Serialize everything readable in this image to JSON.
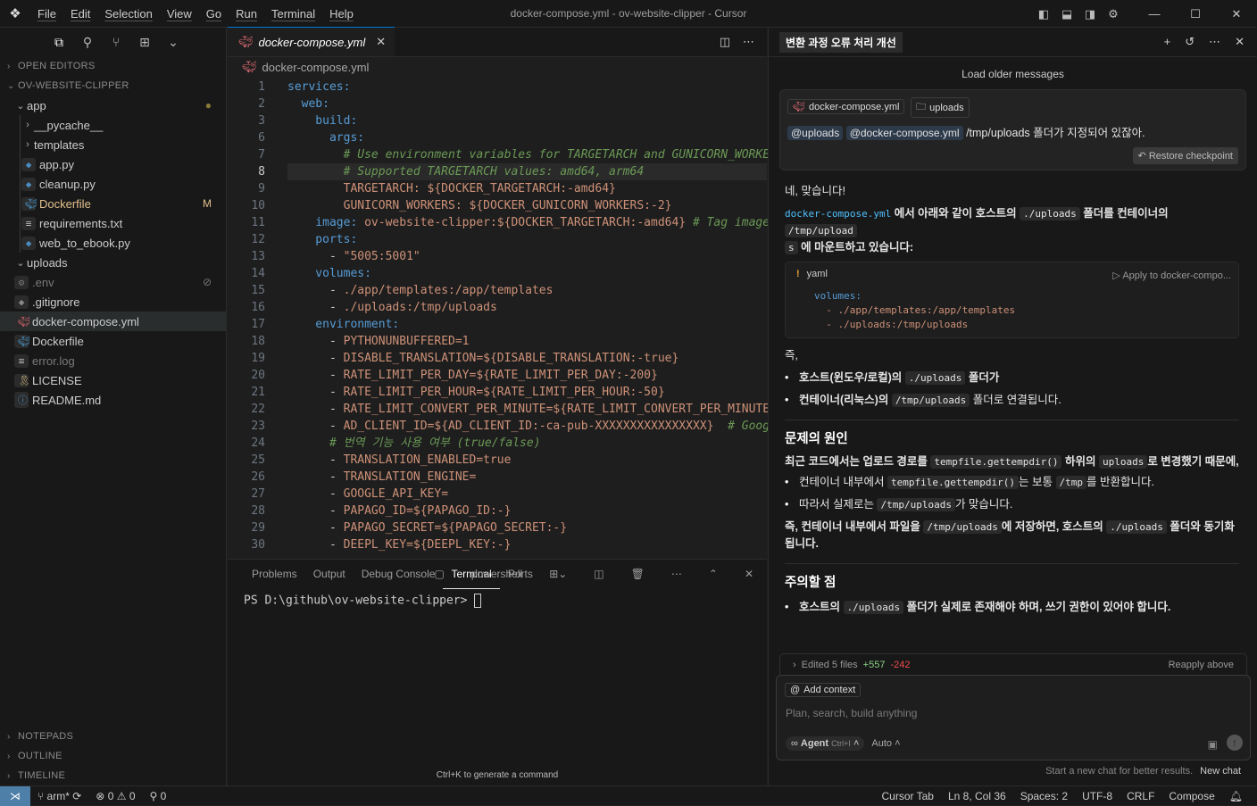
{
  "titlebar": {
    "menus": [
      "File",
      "Edit",
      "Selection",
      "View",
      "Go",
      "Run",
      "Terminal",
      "Help"
    ],
    "window_title": "docker-compose.yml - ov-website-clipper - Cursor"
  },
  "sidebar": {
    "open_editors": "OPEN EDITORS",
    "project": "OV-WEBSITE-CLIPPER",
    "tree": [
      {
        "label": "app",
        "type": "folder-open",
        "depth": 0,
        "badge": "●",
        "badge_color": "#8a7a3a",
        "color": "#cccccc"
      },
      {
        "label": "__pycache__",
        "type": "folder",
        "depth": 1
      },
      {
        "label": "templates",
        "type": "folder",
        "depth": 1
      },
      {
        "label": "app.py",
        "type": "file-py",
        "depth": 1
      },
      {
        "label": "cleanup.py",
        "type": "file-py",
        "depth": 1
      },
      {
        "label": "Dockerfile",
        "type": "file-docker",
        "depth": 1,
        "badge": "M",
        "badge_color": "#e2c08d",
        "color": "#e2c08d"
      },
      {
        "label": "requirements.txt",
        "type": "file-txt",
        "depth": 1
      },
      {
        "label": "web_to_ebook.py",
        "type": "file-py",
        "depth": 1
      },
      {
        "label": "uploads",
        "type": "folder-open",
        "depth": 0
      },
      {
        "label": ".env",
        "type": "file-gear",
        "depth": 0,
        "dim": true,
        "badge": "⊘"
      },
      {
        "label": ".gitignore",
        "type": "file-git",
        "depth": 0
      },
      {
        "label": "docker-compose.yml",
        "type": "file-compose",
        "depth": 0,
        "selected": true
      },
      {
        "label": "Dockerfile",
        "type": "file-docker",
        "depth": 0
      },
      {
        "label": "error.log",
        "type": "file-txt",
        "depth": 0,
        "dim": true
      },
      {
        "label": "LICENSE",
        "type": "file-license",
        "depth": 0
      },
      {
        "label": "README.md",
        "type": "file-info",
        "depth": 0
      }
    ],
    "bottom_sections": [
      "NOTEPADS",
      "OUTLINE",
      "TIMELINE"
    ]
  },
  "editor": {
    "tab_label": "docker-compose.yml",
    "breadcrumb": "docker-compose.yml",
    "current_line": 8,
    "lines": [
      {
        "n": "1",
        "segs": [
          {
            "t": "services:",
            "c": "k"
          }
        ]
      },
      {
        "n": "2",
        "segs": [
          {
            "t": "  web:",
            "c": "k"
          }
        ]
      },
      {
        "n": "3",
        "segs": [
          {
            "t": "    build:",
            "c": "k"
          }
        ]
      },
      {
        "n": "6",
        "segs": [
          {
            "t": "      args:",
            "c": "k"
          }
        ]
      },
      {
        "n": "7",
        "segs": [
          {
            "t": "        # Use environment variables for TARGETARCH and GUNICORN_WORKERS",
            "c": "c"
          }
        ]
      },
      {
        "n": "8",
        "segs": [
          {
            "t": "        # Supported TARGETARCH values: amd64, arm64",
            "c": "c"
          }
        ]
      },
      {
        "n": "9",
        "segs": [
          {
            "t": "        TARGETARCH: ${DOCKER_TARGETARCH:-amd64}",
            "c": "s"
          }
        ]
      },
      {
        "n": "10",
        "segs": [
          {
            "t": "        GUNICORN_WORKERS: ${DOCKER_GUNICORN_WORKERS:-2}",
            "c": "s"
          }
        ]
      },
      {
        "n": "11",
        "segs": [
          {
            "t": "    image: ",
            "c": "k"
          },
          {
            "t": "ov-website-clipper:${DOCKER_TARGETARCH:-amd64}",
            "c": "s"
          },
          {
            "t": " # Tag image",
            "c": "c"
          }
        ]
      },
      {
        "n": "12",
        "segs": [
          {
            "t": "    ports:",
            "c": "k"
          }
        ]
      },
      {
        "n": "13",
        "segs": [
          {
            "t": "      - ",
            "c": "p"
          },
          {
            "t": "\"5005:5001\"",
            "c": "s"
          }
        ]
      },
      {
        "n": "14",
        "segs": [
          {
            "t": "    volumes:",
            "c": "k"
          }
        ]
      },
      {
        "n": "15",
        "segs": [
          {
            "t": "      - ",
            "c": "p"
          },
          {
            "t": "./app/templates:/app/templates",
            "c": "s"
          }
        ]
      },
      {
        "n": "16",
        "segs": [
          {
            "t": "      - ",
            "c": "p"
          },
          {
            "t": "./uploads:/tmp/uploads",
            "c": "s"
          }
        ]
      },
      {
        "n": "17",
        "segs": [
          {
            "t": "    environment:",
            "c": "k"
          }
        ]
      },
      {
        "n": "18",
        "segs": [
          {
            "t": "      - ",
            "c": "p"
          },
          {
            "t": "PYTHONUNBUFFERED=1",
            "c": "s"
          }
        ]
      },
      {
        "n": "19",
        "segs": [
          {
            "t": "      - ",
            "c": "p"
          },
          {
            "t": "DISABLE_TRANSLATION=${DISABLE_TRANSLATION:-true}",
            "c": "s"
          }
        ]
      },
      {
        "n": "20",
        "segs": [
          {
            "t": "      - ",
            "c": "p"
          },
          {
            "t": "RATE_LIMIT_PER_DAY=${RATE_LIMIT_PER_DAY:-200}",
            "c": "s"
          }
        ]
      },
      {
        "n": "21",
        "segs": [
          {
            "t": "      - ",
            "c": "p"
          },
          {
            "t": "RATE_LIMIT_PER_HOUR=${RATE_LIMIT_PER_HOUR:-50}",
            "c": "s"
          }
        ]
      },
      {
        "n": "22",
        "segs": [
          {
            "t": "      - ",
            "c": "p"
          },
          {
            "t": "RATE_LIMIT_CONVERT_PER_MINUTE=${RATE_LIMIT_CONVERT_PER_MINUTE:",
            "c": "s"
          }
        ]
      },
      {
        "n": "23",
        "segs": [
          {
            "t": "      - ",
            "c": "p"
          },
          {
            "t": "AD_CLIENT_ID=${AD_CLIENT_ID:-ca-pub-XXXXXXXXXXXXXXXX}",
            "c": "s"
          },
          {
            "t": "  # Googl",
            "c": "c"
          }
        ]
      },
      {
        "n": "24",
        "segs": [
          {
            "t": "      # 번역 기능 사용 여부 (true/false)",
            "c": "c"
          }
        ]
      },
      {
        "n": "25",
        "segs": [
          {
            "t": "      - ",
            "c": "p"
          },
          {
            "t": "TRANSLATION_ENABLED=true",
            "c": "s"
          }
        ]
      },
      {
        "n": "26",
        "segs": [
          {
            "t": "      - ",
            "c": "p"
          },
          {
            "t": "TRANSLATION_ENGINE=",
            "c": "s"
          }
        ]
      },
      {
        "n": "27",
        "segs": [
          {
            "t": "      - ",
            "c": "p"
          },
          {
            "t": "GOOGLE_API_KEY=",
            "c": "s"
          }
        ]
      },
      {
        "n": "28",
        "segs": [
          {
            "t": "      - ",
            "c": "p"
          },
          {
            "t": "PAPAGO_ID=${PAPAGO_ID:-}",
            "c": "s"
          }
        ]
      },
      {
        "n": "29",
        "segs": [
          {
            "t": "      - ",
            "c": "p"
          },
          {
            "t": "PAPAGO_SECRET=${PAPAGO_SECRET:-}",
            "c": "s"
          }
        ]
      },
      {
        "n": "30",
        "segs": [
          {
            "t": "      - ",
            "c": "p"
          },
          {
            "t": "DEEPL_KEY=${DEEPL_KEY:-}",
            "c": "s"
          }
        ]
      }
    ]
  },
  "panel": {
    "tabs": [
      "Problems",
      "Output",
      "Debug Console",
      "Terminal",
      "Ports"
    ],
    "active_tab": "Terminal",
    "shell": "powershell",
    "prompt": "PS D:\\github\\ov-website-clipper> ",
    "hint": "Ctrl+K to generate a command"
  },
  "chat": {
    "title": "변환 과정 오류 처리 개선",
    "load_older": "Load older messages",
    "user_pills": [
      "docker-compose.yml",
      "uploads"
    ],
    "user_refs": [
      "@uploads",
      "@docker-compose.yml"
    ],
    "user_text": "/tmp/uploads 폴더가 지정되어 있잖아.",
    "restore": "Restore checkpoint",
    "a_intro": "네, 맞습니다!",
    "a_p1_file": "docker-compose.yml",
    "a_p1_mid": "에서 아래와 같이 호스트의",
    "a_p1_c1": "./uploads",
    "a_p1_mid2": "폴더를 컨테이너의",
    "a_p1_c2": "/tmp/upload",
    "a_p1_c2b": "s",
    "a_p1_end": "에 마운트하고 있습니다:",
    "code_lang": "yaml",
    "code_apply": "Apply to docker-compo...",
    "code_lines": [
      "volumes:",
      "  - ./app/templates:/app/templates",
      "  - ./uploads:/tmp/uploads"
    ],
    "a_jeuk": "즉,",
    "b1_pre": "호스트(윈도우/로컬)의",
    "b1_code": "./uploads",
    "b1_post": "폴더가",
    "b2_pre": "컨테이너(리눅스)의",
    "b2_code": "/tmp/uploads",
    "b2_post": "폴더로 연결됩니다.",
    "h_cause": "문제의 원인",
    "cause_pre": "최근 코드에서는 업로드 경로를",
    "cause_code1": "tempfile.gettempdir()",
    "cause_mid": "하위의",
    "cause_code2": "uploads",
    "cause_post": "로 변경했기 때문에,",
    "c1_pre": "컨테이너 내부에서",
    "c1_code1": "tempfile.gettempdir()",
    "c1_mid": "는 보통",
    "c1_code2": "/tmp",
    "c1_post": "를 반환합니다.",
    "c2_pre": "따라서 실제로는",
    "c2_code": "/tmp/uploads",
    "c2_post": "가 맞습니다.",
    "sum_pre": "즉, 컨테이너 내부에서 파일을",
    "sum_code1": "/tmp/uploads",
    "sum_mid": "에 저장하면, 호스트의",
    "sum_code2": "./uploads",
    "sum_post": "폴더와 동기화",
    "sum_end": "됩니다.",
    "h_note": "주의할 점",
    "n1_pre": "호스트의",
    "n1_code": "./uploads",
    "n1_post": "폴더가 실제로 존재해야 하며, 쓰기 권한이 있어야 합니다.",
    "edited": "Edited 5 files",
    "edited_add": "+557",
    "edited_del": "-242",
    "reapply": "Reapply above",
    "add_context": "Add context",
    "input_placeholder": "Plan, search, build anything",
    "mode": "Agent",
    "mode_key": "Ctrl+I",
    "model": "Auto",
    "foot_hint": "Start a new chat for better results.",
    "new_chat": "New chat"
  },
  "status": {
    "branch": "arm*",
    "errors": "0",
    "warnings": "0",
    "ports": "0",
    "items": [
      "Cursor Tab",
      "Ln 8, Col 36",
      "Spaces: 2",
      "UTF-8",
      "CRLF",
      "Compose"
    ]
  }
}
